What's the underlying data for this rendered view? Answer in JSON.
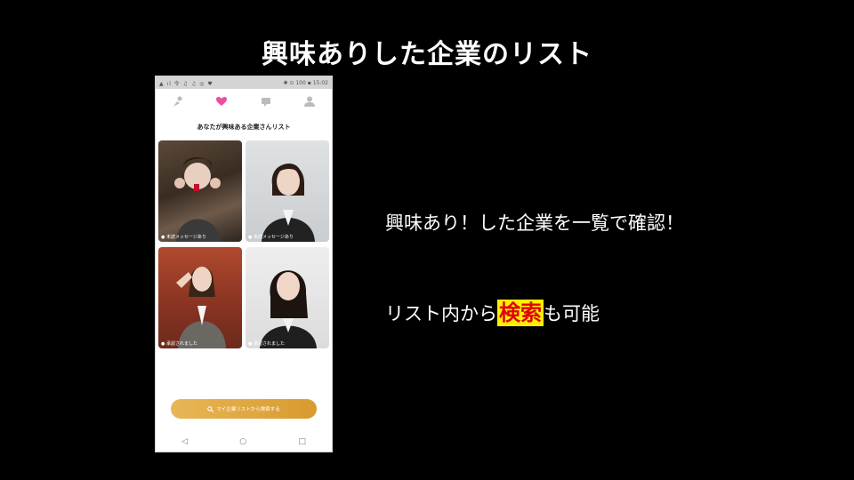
{
  "slide": {
    "title": "興味ありした企業のリスト"
  },
  "phone": {
    "status_left": "▲ ıl 令 ♫ ♫ ◎ ♥",
    "status_right": "✱ ⊙ 100 ▪ 15:02",
    "tabs": [
      {
        "icon": "people-icon",
        "active": false
      },
      {
        "icon": "heart-icon",
        "active": true
      },
      {
        "icon": "chat-icon",
        "active": false
      },
      {
        "icon": "person-icon",
        "active": false
      }
    ],
    "list_title": "あなたが興味ある企業さんリスト",
    "cards": [
      {
        "caption": "● 未読メッセージあり",
        "photo": "woman-photo-1"
      },
      {
        "caption": "● 未読メッセージあり",
        "photo": "woman-photo-2"
      },
      {
        "caption": "● 承認されました",
        "photo": "woman-photo-3"
      },
      {
        "caption": "● 承認されました",
        "photo": "woman-photo-4"
      }
    ],
    "search_button": "マイ企業リストから検索する",
    "nav": {
      "back": "◁",
      "home": "○",
      "recent": "□"
    }
  },
  "right_text": {
    "line1": "興味あり！した企業を一覧で確認！",
    "line2_before": "リスト内から",
    "line2_highlight": "検索",
    "line2_after": "も可能"
  },
  "colors": {
    "accent_heart": "#ec4fa0",
    "search_button": "#e0a640",
    "highlight_bg": "#ffef00",
    "highlight_text": "#e0000c"
  }
}
